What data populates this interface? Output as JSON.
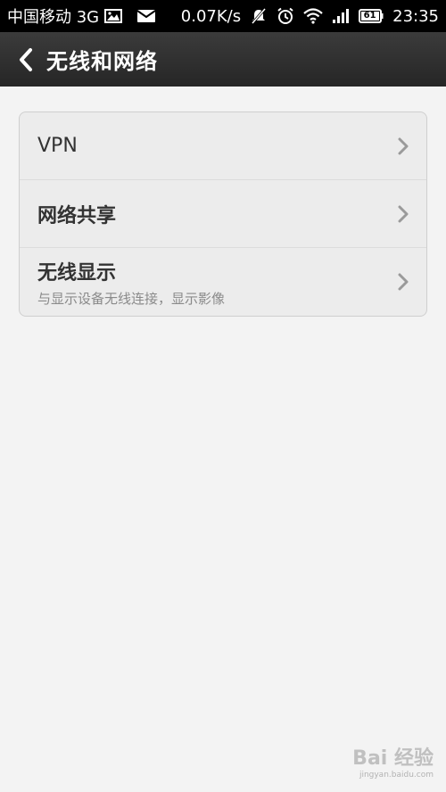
{
  "status_bar": {
    "carrier": "中国移动 3G",
    "speed": "0.07K/s",
    "battery": "61",
    "time": "23:35",
    "icons": [
      "image-icon",
      "mail-icon",
      "mute-icon",
      "alarm-icon",
      "wifi-icon",
      "signal-icon",
      "battery-icon"
    ]
  },
  "title_bar": {
    "back_icon": "back-arrow-icon",
    "title": "无线和网络"
  },
  "settings": {
    "items": [
      {
        "title": "VPN",
        "subtitle": ""
      },
      {
        "title": "网络共享",
        "subtitle": ""
      },
      {
        "title": "无线显示",
        "subtitle": "与显示设备无线连接，显示影像"
      }
    ]
  },
  "watermark": {
    "logo_text": "Bai 经验",
    "url": "jingyan.baidu.com"
  },
  "colors": {
    "status_bar_bg": "#000000",
    "title_bar_bg": "#2e2e2e",
    "page_bg": "#f3f3f3",
    "card_bg": "#ececec"
  }
}
